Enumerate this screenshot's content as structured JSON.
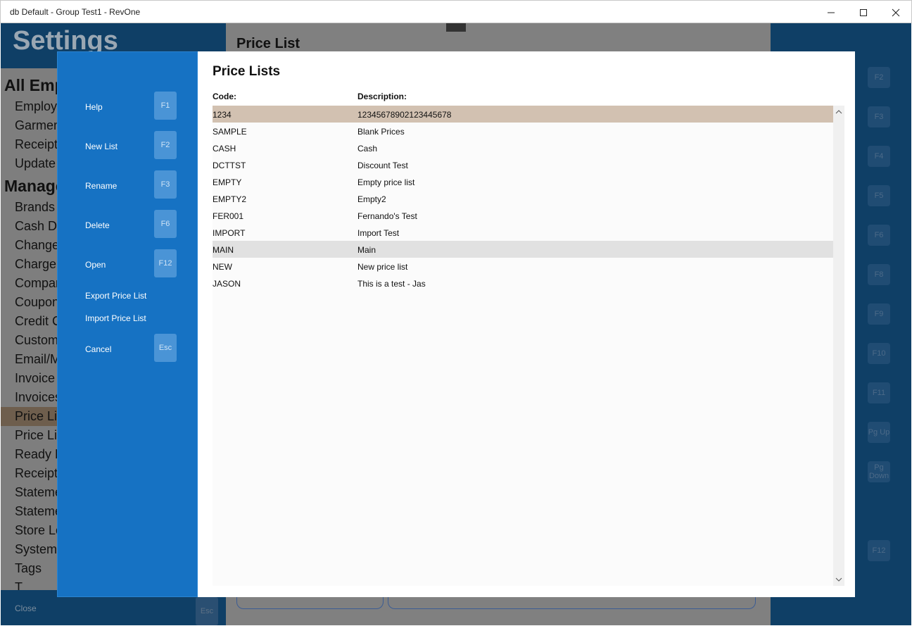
{
  "window": {
    "title": "db Default - Group Test1 - RevOne"
  },
  "background": {
    "settings_title": "Settings",
    "sections": [
      "All Emp",
      "Manage"
    ],
    "items_top": [
      "Employe",
      "Garmen",
      "Receipt",
      "Update"
    ],
    "items_manage": [
      "Brands",
      "Cash Dra",
      "Change",
      "Charge A",
      "Compar",
      "Coupon",
      "Credit C",
      "Custome",
      "Email/M",
      "Invoice I",
      "Invoices",
      "Price Lis",
      "Price Lis",
      "Ready B",
      "Receipt",
      "Stateme",
      "Stateme",
      "Store Lo",
      "System",
      "Tags",
      "T"
    ],
    "close_label": "Close",
    "esc_label": "Esc",
    "center_title": "Price List",
    "fkeys": [
      "F2",
      "F3",
      "F4",
      "F5",
      "F6",
      "F8",
      "F9",
      "F10",
      "F11",
      "Pg Up",
      "Pg Down",
      "F12"
    ]
  },
  "dialog": {
    "heading": "Price Lists",
    "columns": {
      "code": "Code:",
      "description": "Description:"
    },
    "commands": [
      {
        "label": "Help",
        "key": "F1"
      },
      {
        "label": "New List",
        "key": "F2"
      },
      {
        "label": "Rename",
        "key": "F3"
      },
      {
        "label": "Delete",
        "key": "F6"
      },
      {
        "label": "Open",
        "key": "F12"
      },
      {
        "label": "Export Price List",
        "key": ""
      },
      {
        "label": "Import Price List",
        "key": ""
      },
      {
        "label": "Cancel",
        "key": "Esc"
      }
    ],
    "rows": [
      {
        "code": "1234",
        "description": "12345678902123445678"
      },
      {
        "code": "SAMPLE",
        "description": "Blank Prices"
      },
      {
        "code": "CASH",
        "description": "Cash"
      },
      {
        "code": "DCTTST",
        "description": "Discount Test"
      },
      {
        "code": "EMPTY",
        "description": "Empty price list"
      },
      {
        "code": "EMPTY2",
        "description": "Empty2"
      },
      {
        "code": "FER001",
        "description": "Fernando's Test"
      },
      {
        "code": "IMPORT",
        "description": "Import Test"
      },
      {
        "code": "MAIN",
        "description": "Main"
      },
      {
        "code": "NEW",
        "description": "New price list"
      },
      {
        "code": "JASON",
        "description": "This is a test - Jas"
      }
    ],
    "selected_row": 0,
    "hover_row": 8
  },
  "colors": {
    "dialog_side": "#1672c3",
    "selected_row": "#d2c1b1",
    "hover_row": "#e1e1e1",
    "background_dark": "#0f3f66"
  }
}
